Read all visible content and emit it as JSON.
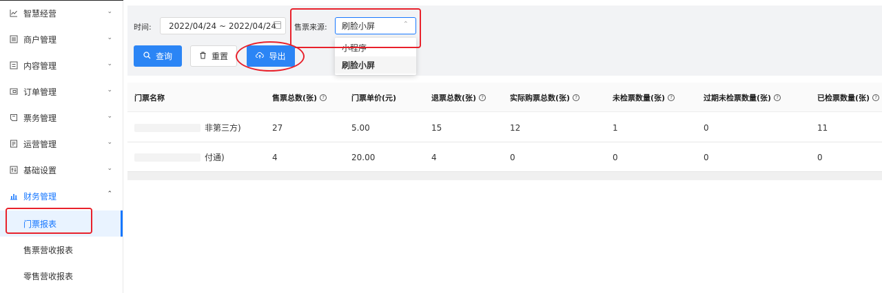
{
  "sidebar": {
    "items": [
      {
        "label": "智慧经营",
        "icon": "chart-line-icon",
        "expanded": false
      },
      {
        "label": "商户管理",
        "icon": "list-box-icon",
        "expanded": false
      },
      {
        "label": "内容管理",
        "icon": "content-box-icon",
        "expanded": false
      },
      {
        "label": "订单管理",
        "icon": "order-card-icon",
        "expanded": false
      },
      {
        "label": "票务管理",
        "icon": "ticket-icon",
        "expanded": false
      },
      {
        "label": "运营管理",
        "icon": "calendar-box-icon",
        "expanded": false
      },
      {
        "label": "基础设置",
        "icon": "settings-grid-icon",
        "expanded": false
      },
      {
        "label": "财务管理",
        "icon": "bar-chart-icon",
        "expanded": true
      }
    ],
    "sub_items": [
      {
        "label": "门票报表",
        "active": true
      },
      {
        "label": "售票营收报表",
        "active": false
      },
      {
        "label": "零售营收报表",
        "active": false
      }
    ]
  },
  "filters": {
    "time_label": "时间:",
    "date_range": "2022/04/24 ~ 2022/04/24",
    "source_label": "售票来源:",
    "source_value": "刷脸小屏",
    "source_options": [
      "小程序",
      "刷脸小屏"
    ]
  },
  "buttons": {
    "query": "查询",
    "reset": "重置",
    "export": "导出"
  },
  "table": {
    "columns": [
      "门票名称",
      "售票总数(张)",
      "门票单价(元)",
      "退票总数(张)",
      "实际购票总数(张)",
      "未检票数量(张)",
      "过期未检票数量(张)",
      "已检票数量(张)"
    ],
    "rows": [
      [
        "非第三方)",
        "27",
        "5.00",
        "15",
        "12",
        "1",
        "0",
        "11"
      ],
      [
        "付通)",
        "4",
        "20.00",
        "4",
        "0",
        "0",
        "0",
        "0"
      ]
    ]
  },
  "colors": {
    "primary": "#2b85f5",
    "active": "#1677ff",
    "highlight": "#e8202a"
  }
}
